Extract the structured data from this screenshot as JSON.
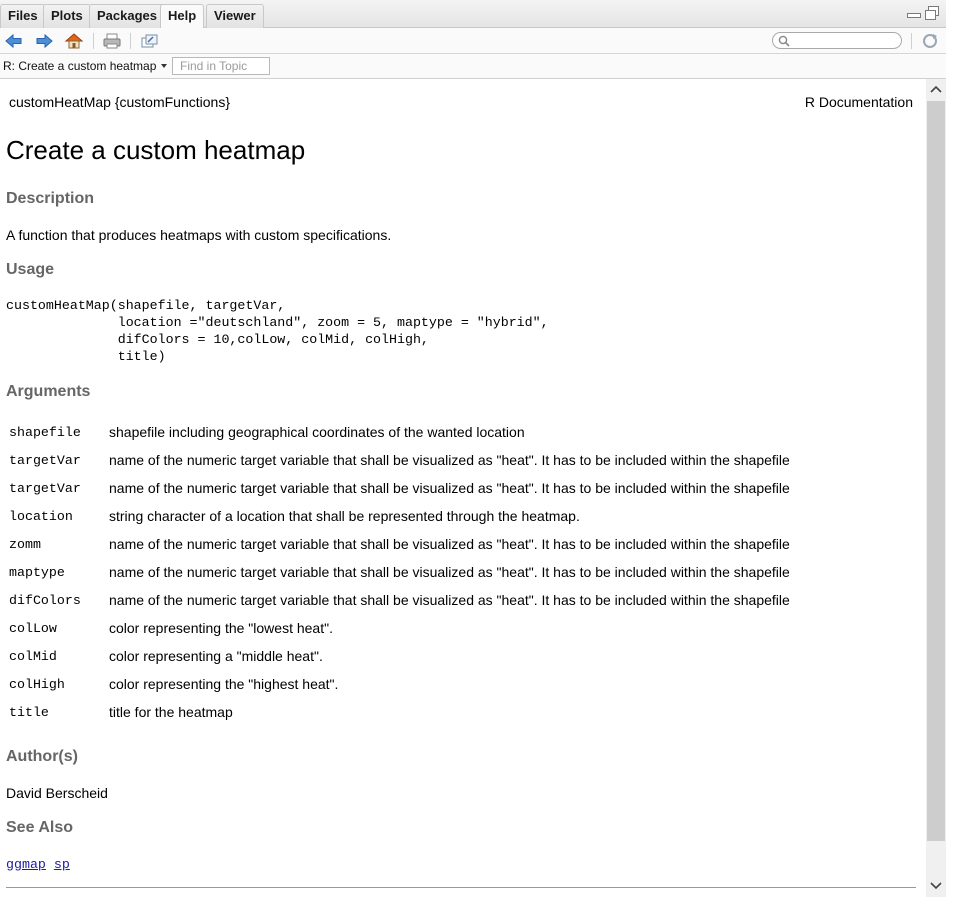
{
  "tabs": [
    {
      "label": "Files"
    },
    {
      "label": "Plots"
    },
    {
      "label": "Packages"
    },
    {
      "label": "Help"
    },
    {
      "label": "Viewer"
    }
  ],
  "active_tab": "Help",
  "topic_bar": {
    "selected": "R: Create a custom heatmap",
    "find_placeholder": "Find in Topic"
  },
  "doc": {
    "header_left": "customHeatMap {customFunctions}",
    "header_right": "R Documentation",
    "title": "Create a custom heatmap",
    "description_heading": "Description",
    "description": "A function that produces heatmaps with custom specifications.",
    "usage_heading": "Usage",
    "usage": "customHeatMap(shapefile, targetVar,\n              location =\"deutschland\", zoom = 5, maptype = \"hybrid\",\n              difColors = 10,colLow, colMid, colHigh,\n              title)",
    "arguments_heading": "Arguments",
    "arguments": [
      {
        "name": "shapefile",
        "desc": "shapefile including geographical coordinates of the wanted location"
      },
      {
        "name": "targetVar",
        "desc": "name of the numeric target variable that shall be visualized as \"heat\". It has to be included within the shapefile"
      },
      {
        "name": "targetVar",
        "desc": "name of the numeric target variable that shall be visualized as \"heat\". It has to be included within the shapefile"
      },
      {
        "name": "location",
        "desc": "string character of a location that shall be represented through the heatmap."
      },
      {
        "name": "zomm",
        "desc": "name of the numeric target variable that shall be visualized as \"heat\". It has to be included within the shapefile"
      },
      {
        "name": "maptype",
        "desc": "name of the numeric target variable that shall be visualized as \"heat\". It has to be included within the shapefile"
      },
      {
        "name": "difColors",
        "desc": "name of the numeric target variable that shall be visualized as \"heat\". It has to be included within the shapefile"
      },
      {
        "name": "colLow",
        "desc": "color representing the \"lowest heat\"."
      },
      {
        "name": "colMid",
        "desc": "color representing a \"middle heat\"."
      },
      {
        "name": "colHigh",
        "desc": "color representing the \"highest heat\"."
      },
      {
        "name": "title",
        "desc": "title for the heatmap"
      }
    ],
    "authors_heading": "Author(s)",
    "author": "David Berscheid",
    "see_also_heading": "See Also",
    "see_also": [
      "ggmap",
      "sp"
    ]
  },
  "colors": {
    "heading": "#666666",
    "link": "#1a1aa6",
    "nav_arrow": "#3b7fcf",
    "home": "#e0641b"
  }
}
